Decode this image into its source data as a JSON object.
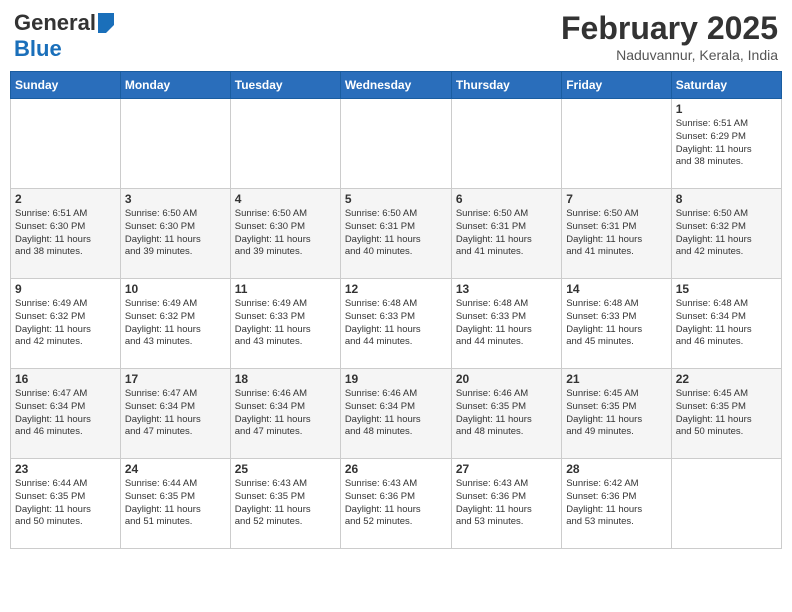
{
  "header": {
    "logo_general": "General",
    "logo_blue": "Blue",
    "month_title": "February 2025",
    "location": "Naduvannur, Kerala, India"
  },
  "weekdays": [
    "Sunday",
    "Monday",
    "Tuesday",
    "Wednesday",
    "Thursday",
    "Friday",
    "Saturday"
  ],
  "weeks": [
    [
      {
        "day": "",
        "info": ""
      },
      {
        "day": "",
        "info": ""
      },
      {
        "day": "",
        "info": ""
      },
      {
        "day": "",
        "info": ""
      },
      {
        "day": "",
        "info": ""
      },
      {
        "day": "",
        "info": ""
      },
      {
        "day": "1",
        "info": "Sunrise: 6:51 AM\nSunset: 6:29 PM\nDaylight: 11 hours\nand 38 minutes."
      }
    ],
    [
      {
        "day": "2",
        "info": "Sunrise: 6:51 AM\nSunset: 6:30 PM\nDaylight: 11 hours\nand 38 minutes."
      },
      {
        "day": "3",
        "info": "Sunrise: 6:50 AM\nSunset: 6:30 PM\nDaylight: 11 hours\nand 39 minutes."
      },
      {
        "day": "4",
        "info": "Sunrise: 6:50 AM\nSunset: 6:30 PM\nDaylight: 11 hours\nand 39 minutes."
      },
      {
        "day": "5",
        "info": "Sunrise: 6:50 AM\nSunset: 6:31 PM\nDaylight: 11 hours\nand 40 minutes."
      },
      {
        "day": "6",
        "info": "Sunrise: 6:50 AM\nSunset: 6:31 PM\nDaylight: 11 hours\nand 41 minutes."
      },
      {
        "day": "7",
        "info": "Sunrise: 6:50 AM\nSunset: 6:31 PM\nDaylight: 11 hours\nand 41 minutes."
      },
      {
        "day": "8",
        "info": "Sunrise: 6:50 AM\nSunset: 6:32 PM\nDaylight: 11 hours\nand 42 minutes."
      }
    ],
    [
      {
        "day": "9",
        "info": "Sunrise: 6:49 AM\nSunset: 6:32 PM\nDaylight: 11 hours\nand 42 minutes."
      },
      {
        "day": "10",
        "info": "Sunrise: 6:49 AM\nSunset: 6:32 PM\nDaylight: 11 hours\nand 43 minutes."
      },
      {
        "day": "11",
        "info": "Sunrise: 6:49 AM\nSunset: 6:33 PM\nDaylight: 11 hours\nand 43 minutes."
      },
      {
        "day": "12",
        "info": "Sunrise: 6:48 AM\nSunset: 6:33 PM\nDaylight: 11 hours\nand 44 minutes."
      },
      {
        "day": "13",
        "info": "Sunrise: 6:48 AM\nSunset: 6:33 PM\nDaylight: 11 hours\nand 44 minutes."
      },
      {
        "day": "14",
        "info": "Sunrise: 6:48 AM\nSunset: 6:33 PM\nDaylight: 11 hours\nand 45 minutes."
      },
      {
        "day": "15",
        "info": "Sunrise: 6:48 AM\nSunset: 6:34 PM\nDaylight: 11 hours\nand 46 minutes."
      }
    ],
    [
      {
        "day": "16",
        "info": "Sunrise: 6:47 AM\nSunset: 6:34 PM\nDaylight: 11 hours\nand 46 minutes."
      },
      {
        "day": "17",
        "info": "Sunrise: 6:47 AM\nSunset: 6:34 PM\nDaylight: 11 hours\nand 47 minutes."
      },
      {
        "day": "18",
        "info": "Sunrise: 6:46 AM\nSunset: 6:34 PM\nDaylight: 11 hours\nand 47 minutes."
      },
      {
        "day": "19",
        "info": "Sunrise: 6:46 AM\nSunset: 6:34 PM\nDaylight: 11 hours\nand 48 minutes."
      },
      {
        "day": "20",
        "info": "Sunrise: 6:46 AM\nSunset: 6:35 PM\nDaylight: 11 hours\nand 48 minutes."
      },
      {
        "day": "21",
        "info": "Sunrise: 6:45 AM\nSunset: 6:35 PM\nDaylight: 11 hours\nand 49 minutes."
      },
      {
        "day": "22",
        "info": "Sunrise: 6:45 AM\nSunset: 6:35 PM\nDaylight: 11 hours\nand 50 minutes."
      }
    ],
    [
      {
        "day": "23",
        "info": "Sunrise: 6:44 AM\nSunset: 6:35 PM\nDaylight: 11 hours\nand 50 minutes."
      },
      {
        "day": "24",
        "info": "Sunrise: 6:44 AM\nSunset: 6:35 PM\nDaylight: 11 hours\nand 51 minutes."
      },
      {
        "day": "25",
        "info": "Sunrise: 6:43 AM\nSunset: 6:35 PM\nDaylight: 11 hours\nand 52 minutes."
      },
      {
        "day": "26",
        "info": "Sunrise: 6:43 AM\nSunset: 6:36 PM\nDaylight: 11 hours\nand 52 minutes."
      },
      {
        "day": "27",
        "info": "Sunrise: 6:43 AM\nSunset: 6:36 PM\nDaylight: 11 hours\nand 53 minutes."
      },
      {
        "day": "28",
        "info": "Sunrise: 6:42 AM\nSunset: 6:36 PM\nDaylight: 11 hours\nand 53 minutes."
      },
      {
        "day": "",
        "info": ""
      }
    ]
  ]
}
